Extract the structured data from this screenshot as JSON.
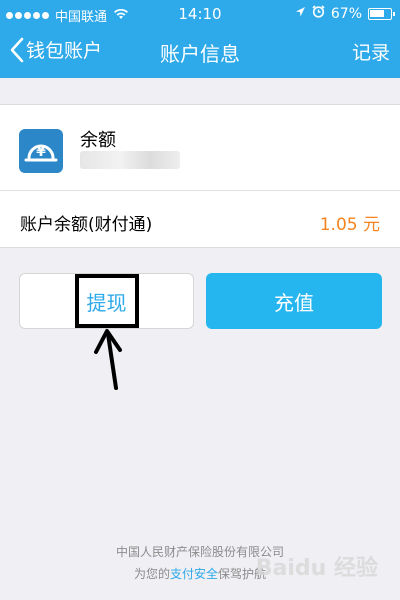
{
  "status_bar": {
    "carrier": "中国联通",
    "time": "14:10",
    "battery": "67%"
  },
  "nav": {
    "back_label": "钱包账户",
    "title": "账户信息",
    "right_label": "记录"
  },
  "balance": {
    "label": "余额",
    "account_label": "账户余额(财付通)",
    "amount": "1.05 元",
    "icon": "coin-yuan-icon"
  },
  "actions": {
    "withdraw_label": "提现",
    "recharge_label": "充值"
  },
  "footer": {
    "line1": "中国人民财产保险股份有限公司",
    "line2_prefix": "为您的",
    "line2_link": "支付安全",
    "line2_suffix": "保驾护航"
  },
  "watermark": {
    "text": "Baidu 经验"
  },
  "colors": {
    "nav_bg": "#2ea9e9",
    "recharge_bg": "#26b6ef",
    "amount": "#f5841f",
    "icon_bg": "#2c87c8"
  }
}
